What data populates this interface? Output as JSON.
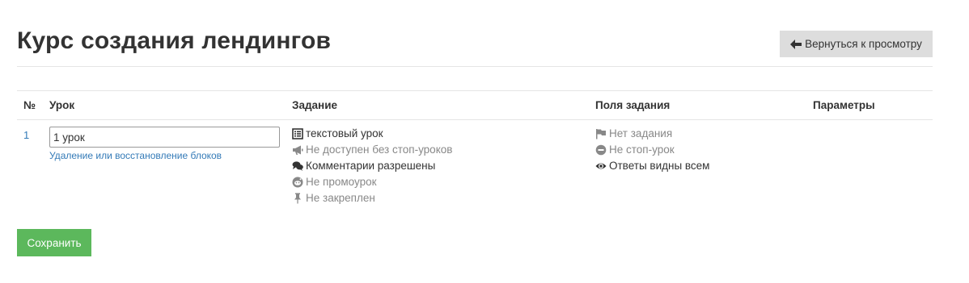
{
  "header": {
    "title": "Курс создания лендингов",
    "back_label": "Вернуться к просмотру"
  },
  "table": {
    "columns": {
      "number": "№",
      "lesson": "Урок",
      "task": "Задание",
      "task_fields": "Поля задания",
      "params": "Параметры"
    },
    "rows": [
      {
        "number": "1",
        "lesson_value": "1 урок",
        "blocks_link": "Удаление или восстановление блоков",
        "task_props": {
          "type": "текстовый урок",
          "stop": "Не доступен без стоп-уроков",
          "comments": "Комментарии разрешены",
          "promo": "Не промоурок",
          "pinned": "Не закреплен"
        },
        "field_props": {
          "task": "Нет задания",
          "stop": "Не стоп-урок",
          "answers": "Ответы видны всем"
        }
      }
    ]
  },
  "actions": {
    "save_label": "Сохранить"
  },
  "colors": {
    "link": "#337ab7",
    "save": "#5cb85c",
    "back": "#dddddd",
    "muted": "#888888"
  }
}
